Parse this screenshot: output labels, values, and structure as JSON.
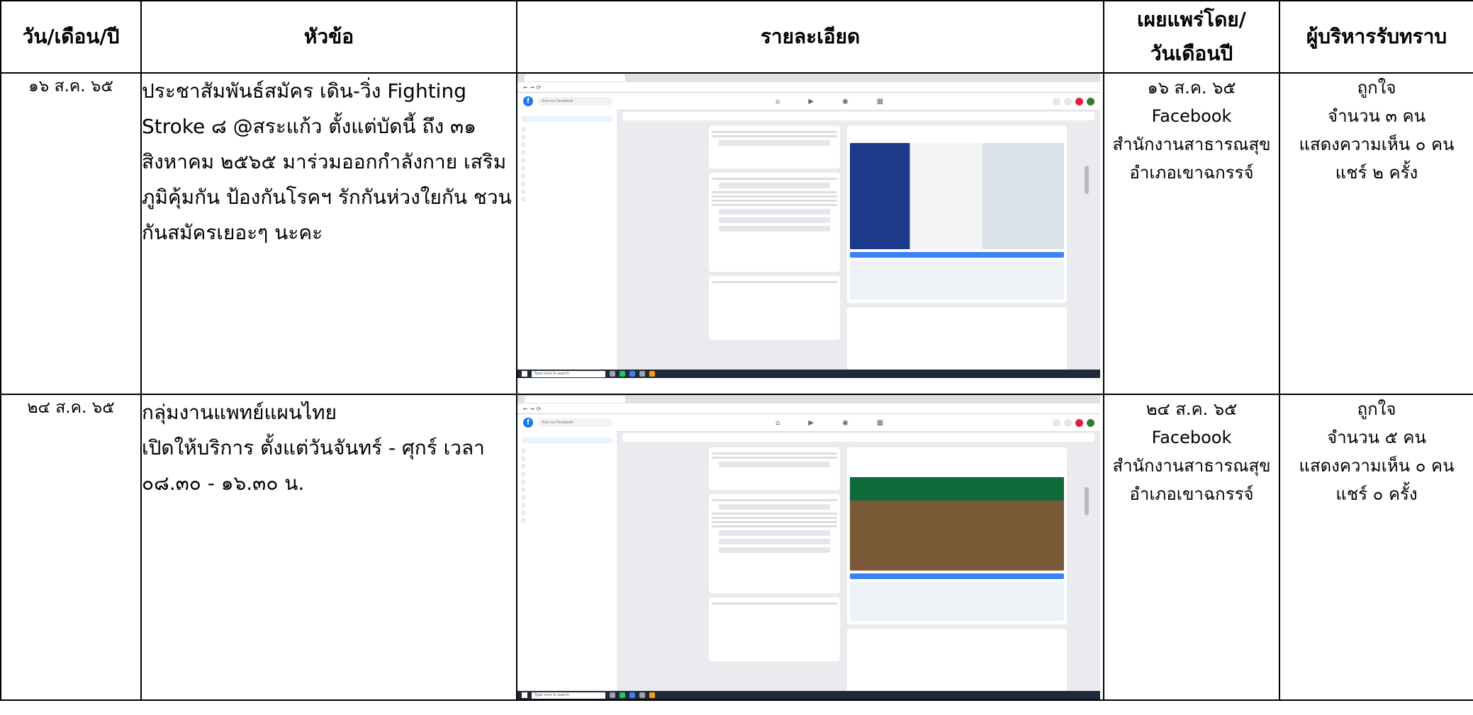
{
  "headers": {
    "date": "วัน/เดือน/ปี",
    "topic": "หัวข้อ",
    "details": "รายละเอียด",
    "published_by_line1": "เผยแพร่โดย/",
    "published_by_line2": "วันเดือนปี",
    "acknowledged": "ผู้บริหารรับทราบ"
  },
  "rows": [
    {
      "date": "๑๖ ส.ค. ๖๕",
      "topic": "ประชาสัมพันธ์สมัคร เดิน-วิ่ง Fighting Stroke ๘ @สระแก้ว ตั้งแต่บัดนี้ ถึง ๓๑ สิงหาคม ๒๕๖๕ มาร่วมออกกำลังกาย เสริมภูมิคุ้มกัน ป้องกันโรคฯ รักกันห่วงใยกัน ชวนกันสมัครเยอะๆ นะคะ",
      "topic_line2": "",
      "published_date": "๑๖ ส.ค. ๖๕",
      "platform": "Facebook",
      "publisher_line1": "สำนักงานสาธารณสุข",
      "publisher_line2": "อำเภอเขาฉกรรจ์",
      "likes": "ถูกใจ",
      "like_count": "จำนวน ๓ คน",
      "comments": "แสดงความเห็น ๐ คน",
      "shares": "แชร์ ๒ ครั้ง",
      "shot_theme": "blue"
    },
    {
      "date": "๒๔ ส.ค. ๖๕",
      "topic": "กลุ่มงานแพทย์แผนไทย",
      "topic_line2": "เปิดให้บริการ ตั้งแต่วันจันทร์ - ศุกร์ เวลา ๐๘.๓๐ - ๑๖.๓๐ น.",
      "published_date": "๒๔ ส.ค. ๖๕",
      "platform": "Facebook",
      "publisher_line1": "สำนักงานสาธารณสุข",
      "publisher_line2": "อำเภอเขาฉกรรจ์",
      "likes": "ถูกใจ",
      "like_count": "จำนวน ๕ คน",
      "comments": "แสดงความเห็น ๐ คน",
      "shares": "แชร์ ๐ ครั้ง",
      "shot_theme": "green"
    }
  ],
  "screenshot": {
    "fb_logo": "f",
    "search_placeholder": "ค้นหาบน Facebook",
    "taskbar_search": "Type here to search",
    "icons": [
      "home-icon",
      "video-icon",
      "marketplace-icon",
      "groups-icon"
    ]
  }
}
